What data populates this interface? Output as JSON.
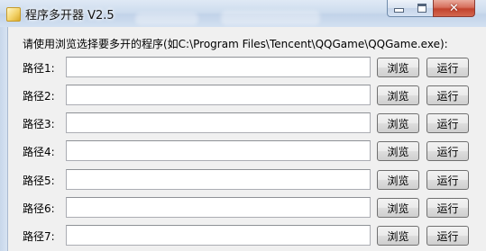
{
  "window": {
    "title": "程序多开器 V2.5",
    "minimize_glyph": "minimize-icon",
    "maximize_glyph": "maximize-icon",
    "close_glyph": "✕"
  },
  "instruction": "请使用浏览选择要多开的程序(如C:\\Program Files\\Tencent\\QQGame\\QQGame.exe):",
  "rows": [
    {
      "label": "路径1:",
      "value": "",
      "browse_label": "浏览",
      "run_label": "运行"
    },
    {
      "label": "路径2:",
      "value": "",
      "browse_label": "浏览",
      "run_label": "运行"
    },
    {
      "label": "路径3:",
      "value": "",
      "browse_label": "浏览",
      "run_label": "运行"
    },
    {
      "label": "路径4:",
      "value": "",
      "browse_label": "浏览",
      "run_label": "运行"
    },
    {
      "label": "路径5:",
      "value": "",
      "browse_label": "浏览",
      "run_label": "运行"
    },
    {
      "label": "路径6:",
      "value": "",
      "browse_label": "浏览",
      "run_label": "运行"
    },
    {
      "label": "路径7:",
      "value": "",
      "browse_label": "浏览",
      "run_label": "运行"
    }
  ],
  "colors": {
    "client_background": "#f0f0f0",
    "close_button": "#c2432e",
    "input_border": "#abadb3"
  }
}
